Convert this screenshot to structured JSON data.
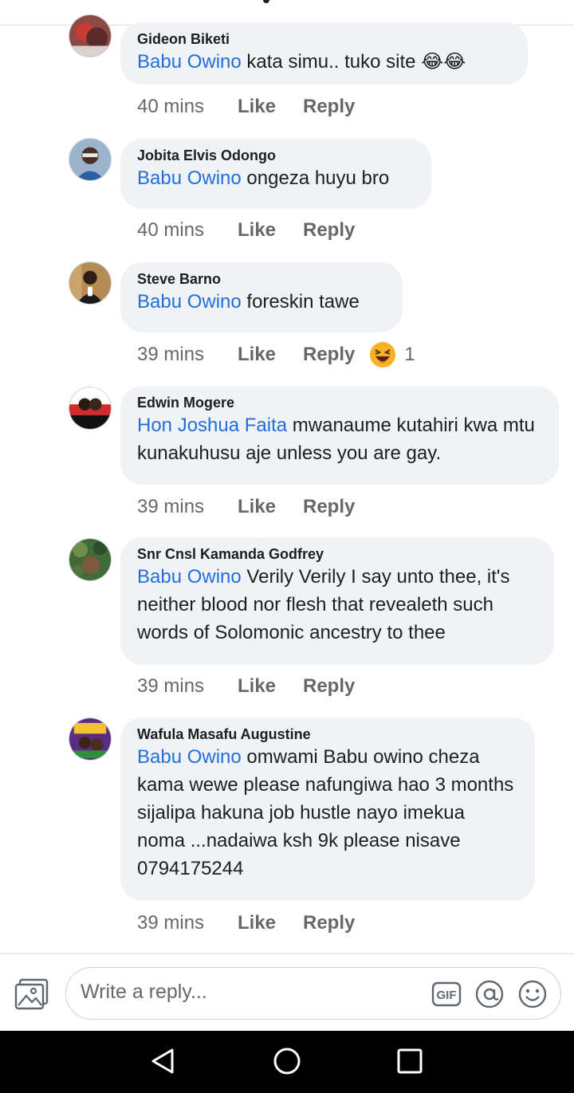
{
  "colors": {
    "mention": "#216fdb",
    "bubble": "#f0f2f5",
    "meta": "#65676b",
    "navbar": "#000000"
  },
  "comments": [
    {
      "author": "Gideon Biketi",
      "mention": "Babu Owino",
      "text": " kata simu.. tuko site 😂😂",
      "time": "40 mins",
      "like": "Like",
      "reply": "Reply"
    },
    {
      "author": "Jobita Elvis Odongo",
      "mention": "Babu Owino",
      "text": " ongeza huyu bro",
      "time": "40 mins",
      "like": "Like",
      "reply": "Reply"
    },
    {
      "author": "Steve Barno",
      "mention": "Babu Owino",
      "text": " foreskin tawe",
      "time": "39 mins",
      "like": "Like",
      "reply": "Reply",
      "reaction": {
        "icon": "laughing-face-icon",
        "count": "1"
      }
    },
    {
      "author": "Edwin Mogere",
      "mention": "Hon Joshua Faita",
      "text": " mwanaume kutahiri kwa mtu kunakuhusu aje unless you are gay.",
      "time": "39 mins",
      "like": "Like",
      "reply": "Reply"
    },
    {
      "author": "Snr Cnsl Kamanda Godfrey",
      "mention": "Babu Owino",
      "text": " Verily Verily I say unto thee, it's neither blood nor flesh that revealeth such words of Solomonic ancestry to thee",
      "time": "39 mins",
      "like": "Like",
      "reply": "Reply"
    },
    {
      "author": "Wafula Masafu Augustine",
      "mention": "Babu Owino",
      "text": " omwami Babu owino cheza kama wewe please nafungiwa hao 3 months sijalipa hakuna job hustle nayo imekua noma ...nadaiwa ksh 9k please nisave 0794175244",
      "time": "39 mins",
      "like": "Like",
      "reply": "Reply"
    }
  ],
  "composer": {
    "placeholder": "Write a reply...",
    "gif_label": "GIF",
    "icons": [
      "photo-icon",
      "gif-icon",
      "at-icon",
      "emoji-icon"
    ]
  },
  "navbar": {
    "icons": [
      "back-icon",
      "home-icon",
      "recent-apps-icon"
    ]
  }
}
